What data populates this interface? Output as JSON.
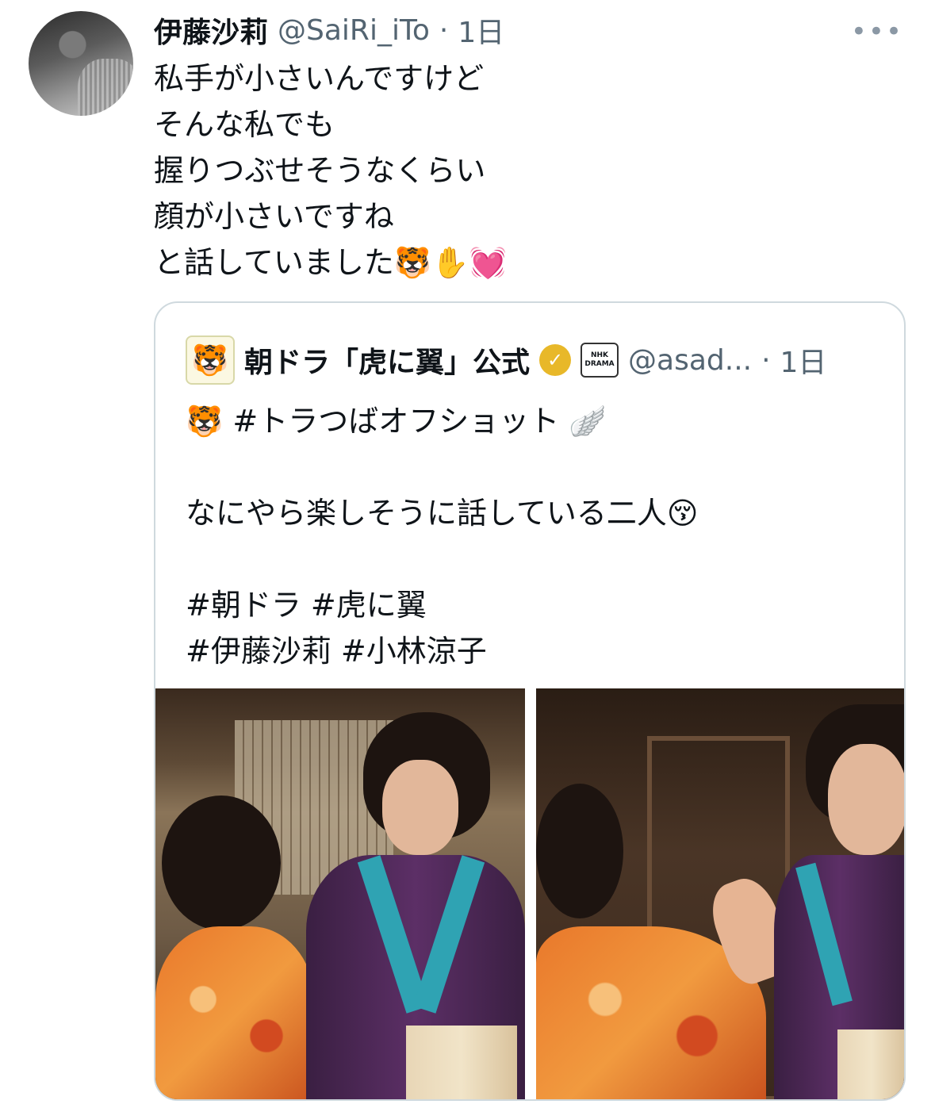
{
  "tweet": {
    "author_name": "伊藤沙莉",
    "handle": "@SaiRi_iTo",
    "dot": "·",
    "time": "1日",
    "more": "•••",
    "lines": [
      "私手が小さいんですけど",
      "そんな私でも",
      "握りつぶせそうなくらい",
      "顔が小さいですね",
      "と話していました🐯✋💓"
    ]
  },
  "quote": {
    "avatar_emoji": "🐯",
    "name": "朝ドラ「虎に翼」公式",
    "verified_mark": "✓",
    "affiliate_badge_line1": "NHK",
    "affiliate_badge_line2": "DRAMA",
    "handle": "@asad...",
    "dot": "·",
    "time": "1日",
    "lines": [
      "🐯 #トラつばオフショット 🪽",
      "",
      "なにやら楽しそうに話している二人😚",
      "",
      "#朝ドラ #虎に翼",
      "#伊藤沙莉 #小林涼子"
    ]
  },
  "icons": {
    "more": "more-icon",
    "verified": "verified-badge-icon",
    "affiliate": "nhk-drama-badge-icon"
  },
  "colors": {
    "secondary_text": "#536471",
    "border": "#cfd9de",
    "verified_gold": "#e8b829"
  }
}
